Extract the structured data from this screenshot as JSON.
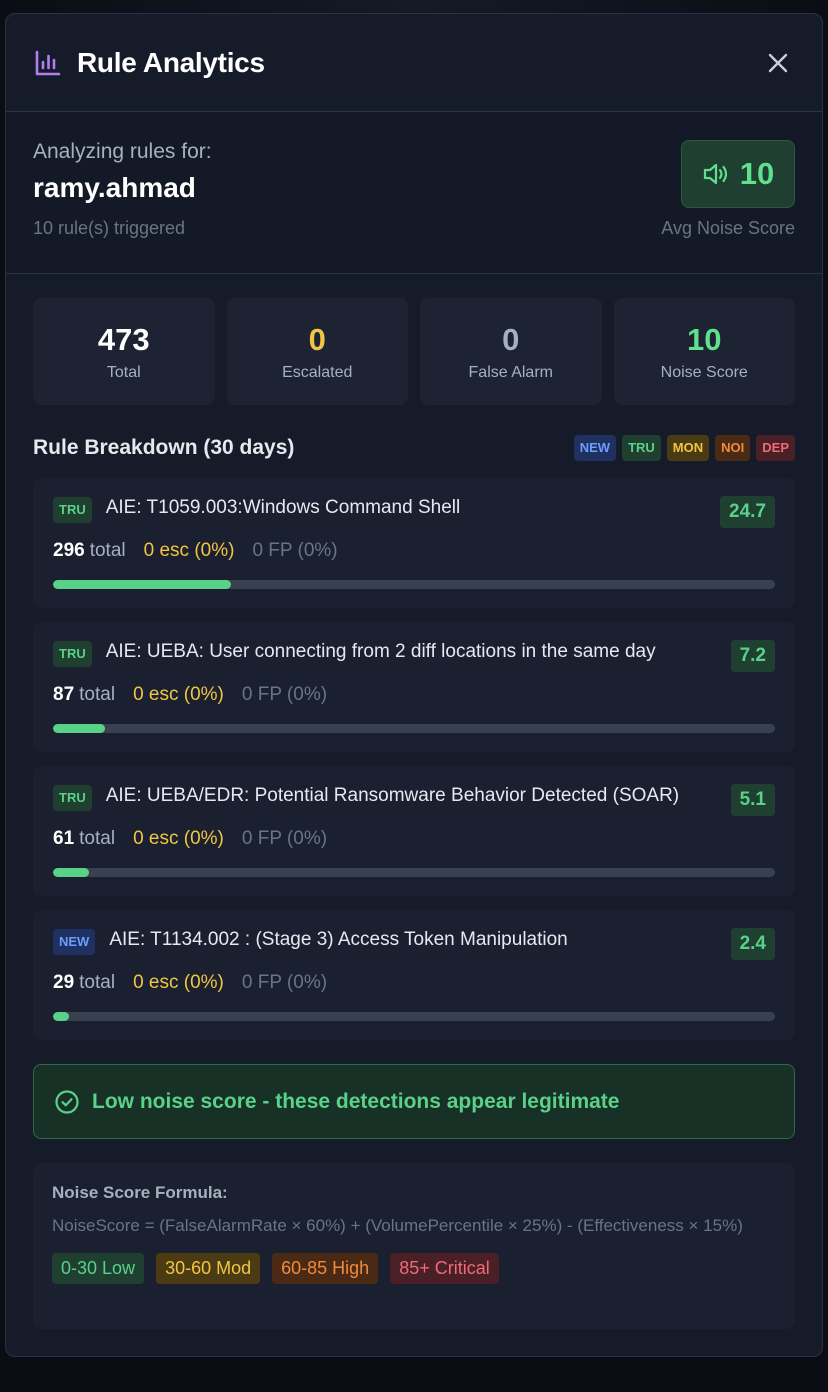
{
  "header": {
    "title": "Rule Analytics",
    "close_label": "×"
  },
  "user": {
    "label": "Analyzing rules for:",
    "name": "ramy.ahmad",
    "rules_triggered": "10 rule(s) triggered",
    "avg_noise_score": "10",
    "avg_noise_caption": "Avg Noise Score"
  },
  "stats": [
    {
      "value": "473",
      "label": "Total",
      "color": "#ffffff"
    },
    {
      "value": "0",
      "label": "Escalated",
      "color": "#f2c443"
    },
    {
      "value": "0",
      "label": "False Alarm",
      "color": "#a8b0bf"
    },
    {
      "value": "10",
      "label": "Noise Score",
      "color": "#5ee08e"
    }
  ],
  "breakdown": {
    "title": "Rule Breakdown (30 days)",
    "legend": [
      "NEW",
      "TRU",
      "MON",
      "NOI",
      "DEP"
    ]
  },
  "rules": [
    {
      "tag": "TRU",
      "name": "AIE: T1059.003:Windows Command Shell",
      "score": "24.7",
      "total": "296",
      "total_label": "total",
      "esc": "0 esc (0%)",
      "fp": "0 FP (0%)",
      "volume_fraction": 0.246
    },
    {
      "tag": "TRU",
      "name": "AIE: UEBA: User connecting from 2 diff locations in the same day",
      "score": "7.2",
      "total": "87",
      "total_label": "total",
      "esc": "0 esc (0%)",
      "fp": "0 FP (0%)",
      "volume_fraction": 0.072
    },
    {
      "tag": "TRU",
      "name": "AIE: UEBA/EDR: Potential Ransomware Behavior Detected (SOAR)",
      "score": "5.1",
      "total": "61",
      "total_label": "total",
      "esc": "0 esc (0%)",
      "fp": "0 FP (0%)",
      "volume_fraction": 0.05
    },
    {
      "tag": "NEW",
      "name": "AIE: T1134.002 : (Stage 3) Access Token Manipulation",
      "score": "2.4",
      "total": "29",
      "total_label": "total",
      "esc": "0 esc (0%)",
      "fp": "0 FP (0%)",
      "volume_fraction": 0.022
    }
  ],
  "notice": {
    "message": "Low noise score - these detections appear legitimate"
  },
  "formula": {
    "title": "Noise Score Formula:",
    "text": "NoiseScore = (FalseAlarmRate × 60%) + (VolumePercentile × 25%) - (Effectiveness × 15%)",
    "ranges": [
      "0-30 Low",
      "30-60 Mod",
      "60-85 High",
      "85+ Critical"
    ]
  },
  "colors": {
    "accent_green": "#5ad188",
    "accent_yellow": "#f2c443",
    "icon_purple": "#b57cf0"
  }
}
